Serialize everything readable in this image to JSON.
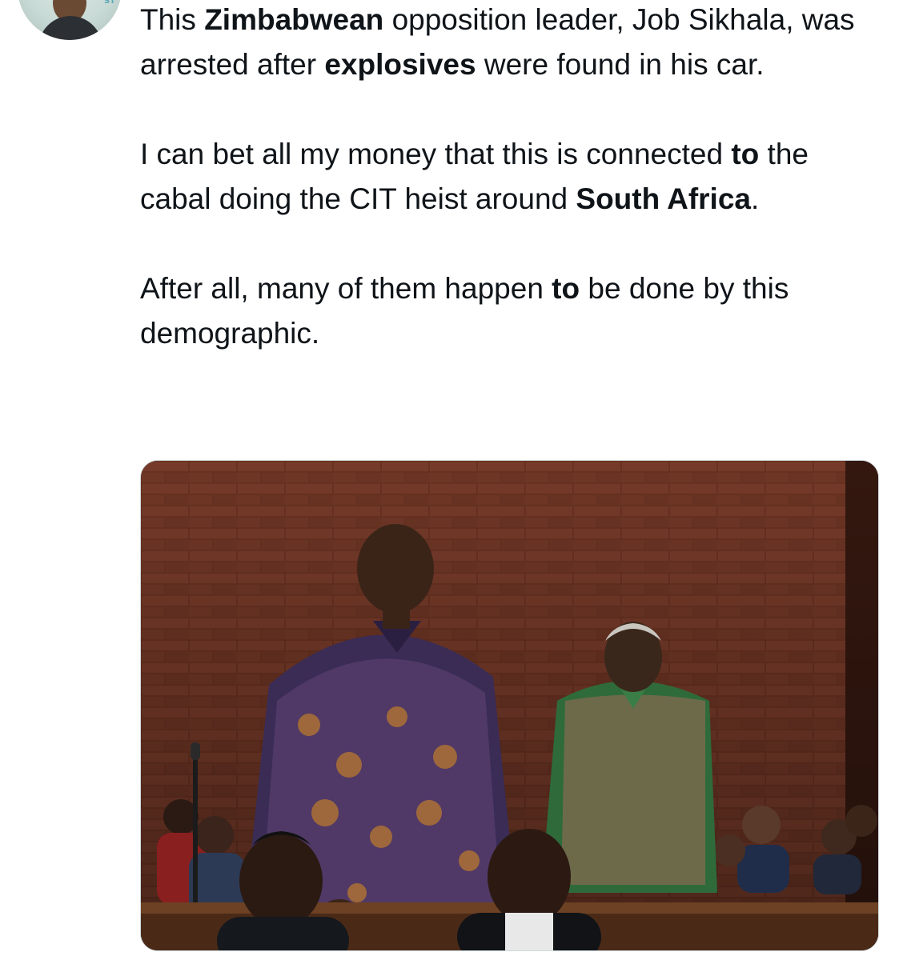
{
  "tweet": {
    "avatar_icon": "user-avatar",
    "avatar_badge": "ST",
    "paragraphs": [
      {
        "segments": [
          {
            "text": "This ",
            "bold": false
          },
          {
            "text": "Zimbabwean",
            "bold": true
          },
          {
            "text": " opposition leader, Job Sikhala, was arrested after ",
            "bold": false
          },
          {
            "text": "explosives",
            "bold": true
          },
          {
            "text": " were found in his car.",
            "bold": false
          }
        ]
      },
      {
        "segments": [
          {
            "text": "I can bet all my money that this is connected ",
            "bold": false
          },
          {
            "text": "to",
            "bold": true
          },
          {
            "text": " the cabal doing the CIT heist around ",
            "bold": false
          },
          {
            "text": "South Africa",
            "bold": true
          },
          {
            "text": ".",
            "bold": false
          }
        ]
      },
      {
        "segments": [
          {
            "text": "After all, many of them happen ",
            "bold": false
          },
          {
            "text": "to",
            "bold": true
          },
          {
            "text": " be done by this demographic.",
            "bold": false
          }
        ]
      }
    ],
    "media": {
      "icon": "courtroom-photo"
    }
  },
  "colors": {
    "text": "#0f1419",
    "background": "#ffffff",
    "media_border": "#cfd9de"
  }
}
